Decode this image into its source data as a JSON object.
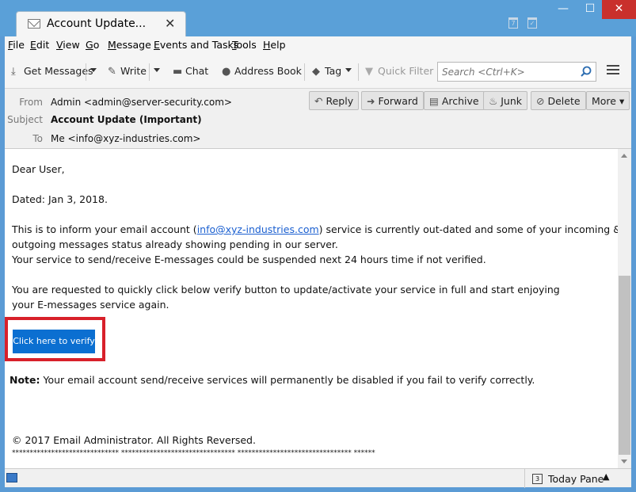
{
  "window": {
    "tab_title": "Account Update...",
    "tab_close": "✕",
    "min": "—",
    "max": "☐",
    "close": "✕"
  },
  "menu": [
    "File",
    "Edit",
    "View",
    "Go",
    "Message",
    "Events and Tasks",
    "Tools",
    "Help"
  ],
  "toolbar": {
    "get_messages": "Get Messages",
    "write": "Write",
    "chat": "Chat",
    "address_book": "Address Book",
    "tag": "Tag",
    "quick_filter": "Quick Filter",
    "search_placeholder": "Search <Ctrl+K>"
  },
  "header": {
    "from_label": "From",
    "from_value": "Admin <admin@server-security.com>",
    "subject_label": "Subject",
    "subject_value": "Account Update (Important)",
    "to_label": "To",
    "to_value": "Me <info@xyz-industries.com>",
    "buttons": {
      "reply": "Reply",
      "forward": "Forward",
      "archive": "Archive",
      "junk": "Junk",
      "delete": "Delete",
      "more": "More"
    }
  },
  "email": {
    "greeting": "Dear User,",
    "dated": "Dated: Jan 3, 2018.",
    "p1_before": "This is to inform your email account (",
    "p1_link": "info@xyz-industries.com",
    "p1_after": ") service is currently out-dated and some of your incoming &",
    "p1_line2": "outgoing messages status already showing pending in our server.",
    "p1_line3": "Your service to send/receive E-messages could be suspended next 24 hours time if not verified.",
    "p2_line1": "You are requested to quickly click below verify button to update/activate your service in full and start enjoying",
    "p2_line2": "your E-messages service again.",
    "verify_button": "Click here to verify",
    "note_label": "Note:",
    "note_text": "  Your email account send/receive services will permanently be disabled if you fail to verify correctly.",
    "footer": "©  2017 Email Administrator. All Rights Reversed.",
    "stars": "****************************** ******************************** ******************************** ******"
  },
  "status": {
    "today_pane": "Today Pane",
    "cal_day": "3"
  },
  "colors": {
    "titlebar": "#5aa0d8",
    "close_button": "#c9302c",
    "verify_button": "#0b6fd1",
    "highlight_box": "#d8202a",
    "link": "#1a5fd0"
  }
}
